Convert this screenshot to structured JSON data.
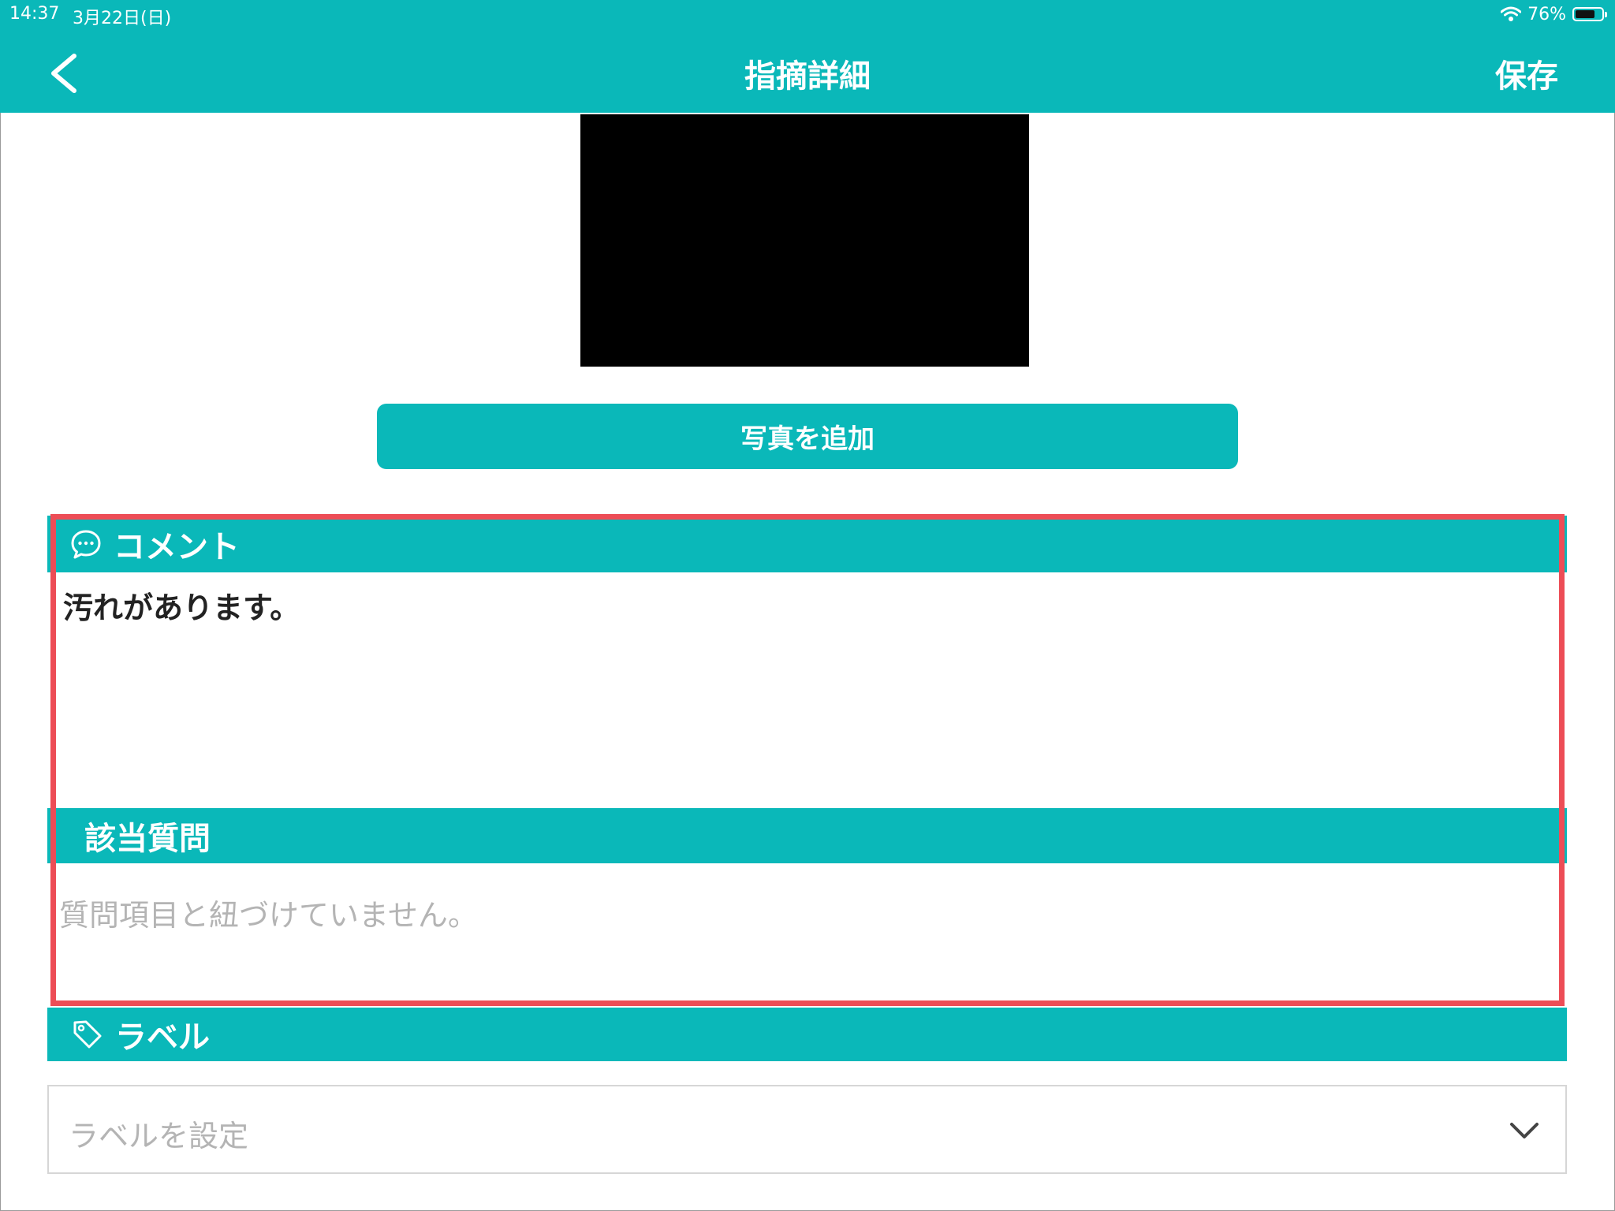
{
  "status_bar": {
    "time": "14:37",
    "date": "3月22日(日)",
    "battery_text": "76%",
    "battery_level": 0.76,
    "wifi_icon": "wifi-icon"
  },
  "nav": {
    "title": "指摘詳細",
    "save_label": "保存",
    "back_icon": "chevron-left-icon"
  },
  "photo": {
    "content": "redacted-black-image"
  },
  "add_photo_label": "写真を追加",
  "comment": {
    "header": "コメント",
    "icon": "speech-bubble-icon",
    "text": "汚れがあります。"
  },
  "question": {
    "header": "該当質問",
    "placeholder": "質問項目と紐づけていません。"
  },
  "label": {
    "header": "ラベル",
    "icon": "tag-icon",
    "select_placeholder": "ラベルを設定",
    "dropdown_icon": "chevron-down-icon"
  },
  "colors": {
    "accent": "#0ab8b9",
    "highlight": "#ed4d56",
    "placeholder": "#b4b4b4"
  }
}
